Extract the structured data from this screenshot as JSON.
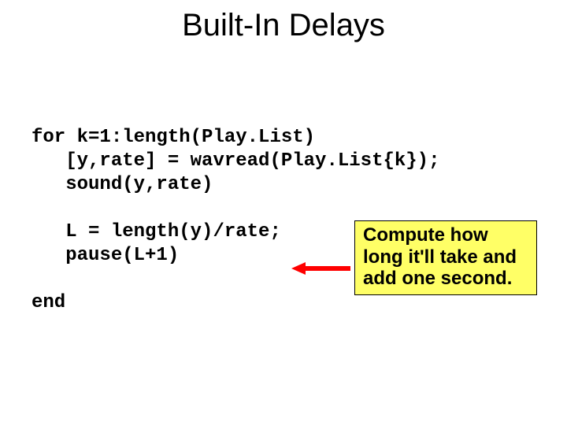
{
  "title": "Built-In Delays",
  "code": {
    "line1": "for k=1:length(Play.List)",
    "line2": "   [y,rate] = wavread(Play.List{k});",
    "line3": "   sound(y,rate)",
    "line4": "",
    "line5": "   L = length(y)/rate;",
    "line6": "   pause(L+1)",
    "line7": "",
    "line8": "end"
  },
  "callout": "Compute how long it'll take and add one second."
}
